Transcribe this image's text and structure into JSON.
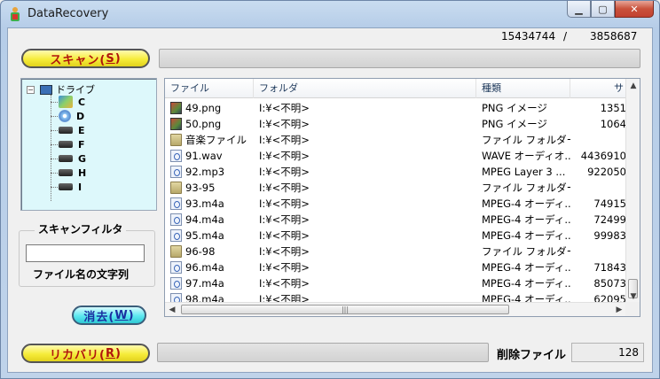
{
  "window": {
    "title": "DataRecovery"
  },
  "counters": {
    "left": "15434744",
    "separator": "/",
    "right": "3858687"
  },
  "scan_button": {
    "text": "スキャン(",
    "key": "S",
    "close": ")"
  },
  "recover_button": {
    "text": "リカバリ(",
    "key": "R",
    "close": ")"
  },
  "clear_button": {
    "text": "消去(",
    "key": "W",
    "close": ")"
  },
  "tree": {
    "root": "ドライブ",
    "drives": [
      {
        "label": "C",
        "icon": "windows-drive-icon"
      },
      {
        "label": "D",
        "icon": "cd-drive-icon"
      },
      {
        "label": "E",
        "icon": "drive-icon"
      },
      {
        "label": "F",
        "icon": "drive-icon"
      },
      {
        "label": "G",
        "icon": "drive-icon"
      },
      {
        "label": "H",
        "icon": "drive-icon"
      },
      {
        "label": "I",
        "icon": "drive-icon"
      }
    ]
  },
  "filter": {
    "title": "スキャンフィルタ",
    "value": "",
    "label": "ファイル名の文字列"
  },
  "list": {
    "columns": [
      "ファイル",
      "フォルダ",
      "種類",
      "サ"
    ],
    "rows": [
      {
        "name": "49.png",
        "folder": "I:¥<不明>",
        "type": "PNG イメージ",
        "size": "1351",
        "icon": "png"
      },
      {
        "name": "50.png",
        "folder": "I:¥<不明>",
        "type": "PNG イメージ",
        "size": "1064",
        "icon": "png"
      },
      {
        "name": "音楽ファイル",
        "folder": "I:¥<不明>",
        "type": "ファイル フォルダー",
        "size": "",
        "icon": "folder"
      },
      {
        "name": "91.wav",
        "folder": "I:¥<不明>",
        "type": "WAVE オーディオ...",
        "size": "4436910",
        "icon": "audio"
      },
      {
        "name": "92.mp3",
        "folder": "I:¥<不明>",
        "type": "MPEG Layer 3 ...",
        "size": "922050",
        "icon": "audio"
      },
      {
        "name": "93-95",
        "folder": "I:¥<不明>",
        "type": "ファイル フォルダー",
        "size": "",
        "icon": "folder"
      },
      {
        "name": "93.m4a",
        "folder": "I:¥<不明>",
        "type": "MPEG-4 オーディ...",
        "size": "74915",
        "icon": "audio"
      },
      {
        "name": "94.m4a",
        "folder": "I:¥<不明>",
        "type": "MPEG-4 オーディ...",
        "size": "72499",
        "icon": "audio"
      },
      {
        "name": "95.m4a",
        "folder": "I:¥<不明>",
        "type": "MPEG-4 オーディ...",
        "size": "99983",
        "icon": "audio"
      },
      {
        "name": "96-98",
        "folder": "I:¥<不明>",
        "type": "ファイル フォルダー",
        "size": "",
        "icon": "folder"
      },
      {
        "name": "96.m4a",
        "folder": "I:¥<不明>",
        "type": "MPEG-4 オーディ...",
        "size": "71843",
        "icon": "audio"
      },
      {
        "name": "97.m4a",
        "folder": "I:¥<不明>",
        "type": "MPEG-4 オーディ...",
        "size": "85073",
        "icon": "audio"
      },
      {
        "name": "98.m4a",
        "folder": "I:¥<不明>",
        "type": "MPEG-4 オーディ...",
        "size": "62095",
        "icon": "audio"
      }
    ]
  },
  "progress": {
    "scan": 0,
    "recover": 0
  },
  "deleted": {
    "label": "削除ファイル",
    "count": "128"
  },
  "colors": {
    "scan_button": "#f6ec3a",
    "clear_button": "#5ce8f0",
    "tree_bg": "#ddf8fb"
  }
}
